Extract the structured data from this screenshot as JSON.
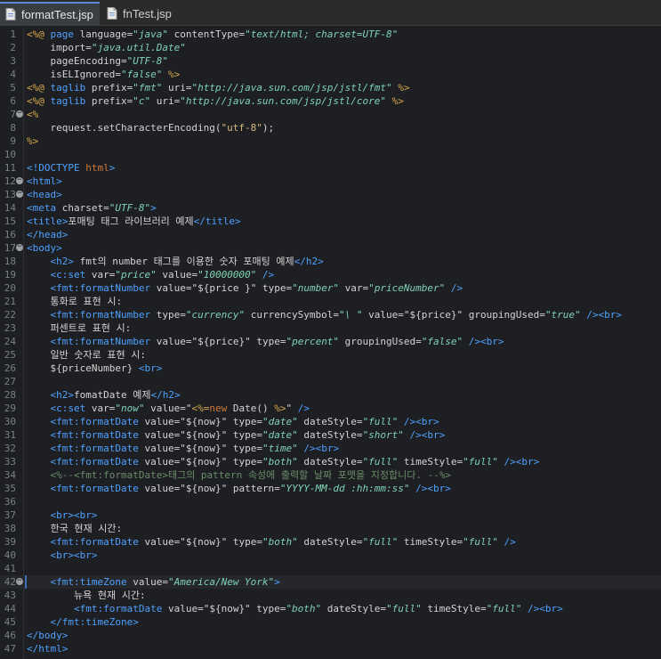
{
  "tabs": [
    {
      "label": "formatTest.jsp",
      "icon": "jsp-file-icon",
      "active": true
    },
    {
      "label": "fnTest.jsp",
      "icon": "jsp-file-icon",
      "active": false
    }
  ],
  "colors": {
    "background": "#1e1f22",
    "tag": "#4ea1ff",
    "value": "#7fd3b6",
    "comment": "#6a8d6a",
    "directive": "#d6a84a"
  },
  "editor": {
    "lines": [
      {
        "n": "1",
        "fold": false,
        "tokens": [
          [
            "dir",
            "<%@ "
          ],
          [
            "tag",
            "page "
          ],
          [
            "attr",
            "language="
          ],
          [
            "val",
            "\"java\""
          ],
          [
            "attr",
            " contentType="
          ],
          [
            "val",
            "\"text/html; charset=UTF-8\""
          ]
        ]
      },
      {
        "n": "2",
        "fold": false,
        "tokens": [
          [
            "attr",
            "    import="
          ],
          [
            "val",
            "\"java.util.Date\""
          ]
        ]
      },
      {
        "n": "3",
        "fold": false,
        "tokens": [
          [
            "attr",
            "    pageEncoding="
          ],
          [
            "val",
            "\"UTF-8\""
          ]
        ]
      },
      {
        "n": "4",
        "fold": false,
        "tokens": [
          [
            "attr",
            "    isELIgnored="
          ],
          [
            "val",
            "\"false\""
          ],
          [
            "dir",
            " %>"
          ]
        ]
      },
      {
        "n": "5",
        "fold": false,
        "tokens": [
          [
            "dir",
            "<%@ "
          ],
          [
            "tag",
            "taglib "
          ],
          [
            "attr",
            "prefix="
          ],
          [
            "val",
            "\"fmt\""
          ],
          [
            "attr",
            " uri="
          ],
          [
            "val",
            "\"http://java.sun.com/jsp/jstl/fmt\""
          ],
          [
            "dir",
            " %>"
          ]
        ]
      },
      {
        "n": "6",
        "fold": false,
        "tokens": [
          [
            "dir",
            "<%@ "
          ],
          [
            "tag",
            "taglib "
          ],
          [
            "attr",
            "prefix="
          ],
          [
            "val",
            "\"c\""
          ],
          [
            "attr",
            " uri="
          ],
          [
            "val",
            "\"http://java.sun.com/jsp/jstl/core\""
          ],
          [
            "dir",
            " %>"
          ]
        ]
      },
      {
        "n": "7",
        "fold": true,
        "tokens": [
          [
            "dir",
            "<%"
          ]
        ]
      },
      {
        "n": "8",
        "fold": false,
        "tokens": [
          [
            "plain",
            "    request.setCharacterEncoding("
          ],
          [
            "str",
            "\"utf-8\""
          ],
          [
            "plain",
            ");"
          ]
        ]
      },
      {
        "n": "9",
        "fold": false,
        "tokens": [
          [
            "dir",
            "%>"
          ]
        ]
      },
      {
        "n": "10",
        "fold": false,
        "tokens": []
      },
      {
        "n": "11",
        "fold": false,
        "tokens": [
          [
            "tag",
            "<!DOCTYPE "
          ],
          [
            "kw",
            "html"
          ],
          [
            "tag",
            ">"
          ]
        ]
      },
      {
        "n": "12",
        "fold": true,
        "tokens": [
          [
            "tag",
            "<html>"
          ]
        ]
      },
      {
        "n": "13",
        "fold": true,
        "tokens": [
          [
            "tag",
            "<head>"
          ]
        ]
      },
      {
        "n": "14",
        "fold": false,
        "tokens": [
          [
            "tag",
            "<meta "
          ],
          [
            "attr",
            "charset="
          ],
          [
            "val",
            "\"UTF-8\""
          ],
          [
            "tag",
            ">"
          ]
        ]
      },
      {
        "n": "15",
        "fold": false,
        "tokens": [
          [
            "tag",
            "<title>"
          ],
          [
            "plain",
            "포매팅 태그 라이브러리 예제"
          ],
          [
            "tag",
            "</title>"
          ]
        ]
      },
      {
        "n": "16",
        "fold": false,
        "tokens": [
          [
            "tag",
            "</head>"
          ]
        ]
      },
      {
        "n": "17",
        "fold": true,
        "tokens": [
          [
            "tag",
            "<body>"
          ]
        ]
      },
      {
        "n": "18",
        "fold": false,
        "tokens": [
          [
            "plain",
            "    "
          ],
          [
            "tag",
            "<h2>"
          ],
          [
            "plain",
            " fmt의 number 태그를 이용한 숫자 포매팅 예제"
          ],
          [
            "tag",
            "</h2>"
          ]
        ]
      },
      {
        "n": "19",
        "fold": false,
        "tokens": [
          [
            "plain",
            "    "
          ],
          [
            "tag",
            "<c:set "
          ],
          [
            "attr",
            "var="
          ],
          [
            "val",
            "\"price\""
          ],
          [
            "attr",
            " value="
          ],
          [
            "val",
            "\"10000000\""
          ],
          [
            "tag",
            " />"
          ]
        ]
      },
      {
        "n": "20",
        "fold": false,
        "tokens": [
          [
            "plain",
            "    "
          ],
          [
            "tag",
            "<fmt:formatNumber "
          ],
          [
            "attr",
            "value="
          ],
          [
            "plain",
            "\"${price }\""
          ],
          [
            "attr",
            " type="
          ],
          [
            "val",
            "\"number\""
          ],
          [
            "attr",
            " var="
          ],
          [
            "val",
            "\"priceNumber\""
          ],
          [
            "tag",
            " />"
          ]
        ]
      },
      {
        "n": "21",
        "fold": false,
        "tokens": [
          [
            "plain",
            "    통화로 표현 시:"
          ]
        ]
      },
      {
        "n": "22",
        "fold": false,
        "tokens": [
          [
            "plain",
            "    "
          ],
          [
            "tag",
            "<fmt:formatNumber "
          ],
          [
            "attr",
            "type="
          ],
          [
            "val",
            "\"currency\""
          ],
          [
            "attr",
            " currencySymbol="
          ],
          [
            "val",
            "\"\\ \""
          ],
          [
            "attr",
            " value="
          ],
          [
            "plain",
            "\"${price}\""
          ],
          [
            "attr",
            " groupingUsed="
          ],
          [
            "val",
            "\"true\""
          ],
          [
            "tag",
            " /><br>"
          ]
        ]
      },
      {
        "n": "23",
        "fold": false,
        "tokens": [
          [
            "plain",
            "    퍼센트로 표현 시:"
          ]
        ]
      },
      {
        "n": "24",
        "fold": false,
        "tokens": [
          [
            "plain",
            "    "
          ],
          [
            "tag",
            "<fmt:formatNumber "
          ],
          [
            "attr",
            "value="
          ],
          [
            "plain",
            "\"${price}\""
          ],
          [
            "attr",
            " type="
          ],
          [
            "val",
            "\"percent\""
          ],
          [
            "attr",
            " groupingUsed="
          ],
          [
            "val",
            "\"false\""
          ],
          [
            "tag",
            " /><br>"
          ]
        ]
      },
      {
        "n": "25",
        "fold": false,
        "tokens": [
          [
            "plain",
            "    일반 숫자로 표현 시:"
          ]
        ]
      },
      {
        "n": "26",
        "fold": false,
        "tokens": [
          [
            "plain",
            "    ${priceNumber} "
          ],
          [
            "tag",
            "<br>"
          ]
        ]
      },
      {
        "n": "27",
        "fold": false,
        "tokens": []
      },
      {
        "n": "28",
        "fold": false,
        "tokens": [
          [
            "plain",
            "    "
          ],
          [
            "tag",
            "<h2>"
          ],
          [
            "plain",
            "fomatDate 예제"
          ],
          [
            "tag",
            "</h2>"
          ]
        ]
      },
      {
        "n": "29",
        "fold": false,
        "tokens": [
          [
            "plain",
            "    "
          ],
          [
            "tag",
            "<c:set "
          ],
          [
            "attr",
            "var="
          ],
          [
            "val",
            "\"now\""
          ],
          [
            "attr",
            " value="
          ],
          [
            "plain",
            "\""
          ],
          [
            "dir",
            "<%="
          ],
          [
            "kw",
            "new"
          ],
          [
            "plain",
            " Date() "
          ],
          [
            "dir",
            "%>"
          ],
          [
            "plain",
            "\""
          ],
          [
            "tag",
            " />"
          ]
        ]
      },
      {
        "n": "30",
        "fold": false,
        "tokens": [
          [
            "plain",
            "    "
          ],
          [
            "tag",
            "<fmt:formatDate "
          ],
          [
            "attr",
            "value="
          ],
          [
            "plain",
            "\"${now}\""
          ],
          [
            "attr",
            " type="
          ],
          [
            "val",
            "\"date\""
          ],
          [
            "attr",
            " dateStyle="
          ],
          [
            "val",
            "\"full\""
          ],
          [
            "tag",
            " /><br>"
          ]
        ]
      },
      {
        "n": "31",
        "fold": false,
        "tokens": [
          [
            "plain",
            "    "
          ],
          [
            "tag",
            "<fmt:formatDate "
          ],
          [
            "attr",
            "value="
          ],
          [
            "plain",
            "\"${now}\""
          ],
          [
            "attr",
            " type="
          ],
          [
            "val",
            "\"date\""
          ],
          [
            "attr",
            " dateStyle="
          ],
          [
            "val",
            "\"short\""
          ],
          [
            "tag",
            " /><br>"
          ]
        ]
      },
      {
        "n": "32",
        "fold": false,
        "tokens": [
          [
            "plain",
            "    "
          ],
          [
            "tag",
            "<fmt:formatDate "
          ],
          [
            "attr",
            "value="
          ],
          [
            "plain",
            "\"${now}\""
          ],
          [
            "attr",
            " type="
          ],
          [
            "val",
            "\"time\""
          ],
          [
            "tag",
            " /><br>"
          ]
        ]
      },
      {
        "n": "33",
        "fold": false,
        "tokens": [
          [
            "plain",
            "    "
          ],
          [
            "tag",
            "<fmt:formatDate "
          ],
          [
            "attr",
            "value="
          ],
          [
            "plain",
            "\"${now}\""
          ],
          [
            "attr",
            " type="
          ],
          [
            "val",
            "\"both\""
          ],
          [
            "attr",
            " dateStyle="
          ],
          [
            "val",
            "\"full\""
          ],
          [
            "attr",
            " timeStyle="
          ],
          [
            "val",
            "\"full\""
          ],
          [
            "tag",
            " /><br>"
          ]
        ]
      },
      {
        "n": "34",
        "fold": false,
        "tokens": [
          [
            "plain",
            "    "
          ],
          [
            "comment",
            "<%--<fmt:formatDate>태그의 pattern 속성에 출력할 날짜 포맷을 지정합니다. --%>"
          ]
        ]
      },
      {
        "n": "35",
        "fold": false,
        "tokens": [
          [
            "plain",
            "    "
          ],
          [
            "tag",
            "<fmt:formatDate "
          ],
          [
            "attr",
            "value="
          ],
          [
            "plain",
            "\"${now}\""
          ],
          [
            "attr",
            " pattern="
          ],
          [
            "val",
            "\"YYYY-MM-dd :hh:mm:ss\""
          ],
          [
            "tag",
            " /><br>"
          ]
        ]
      },
      {
        "n": "36",
        "fold": false,
        "tokens": []
      },
      {
        "n": "37",
        "fold": false,
        "tokens": [
          [
            "plain",
            "    "
          ],
          [
            "tag",
            "<br><br>"
          ]
        ]
      },
      {
        "n": "38",
        "fold": false,
        "tokens": [
          [
            "plain",
            "    한국 현재 시간:"
          ]
        ]
      },
      {
        "n": "39",
        "fold": false,
        "tokens": [
          [
            "plain",
            "    "
          ],
          [
            "tag",
            "<fmt:formatDate "
          ],
          [
            "attr",
            "value="
          ],
          [
            "plain",
            "\"${now}\""
          ],
          [
            "attr",
            " type="
          ],
          [
            "val",
            "\"both\""
          ],
          [
            "attr",
            " dateStyle="
          ],
          [
            "val",
            "\"full\""
          ],
          [
            "attr",
            " timeStyle="
          ],
          [
            "val",
            "\"full\""
          ],
          [
            "tag",
            " />"
          ]
        ]
      },
      {
        "n": "40",
        "fold": false,
        "tokens": [
          [
            "plain",
            "    "
          ],
          [
            "tag",
            "<br><br>"
          ]
        ]
      },
      {
        "n": "41",
        "fold": false,
        "tokens": []
      },
      {
        "n": "42",
        "fold": true,
        "tokens": [
          [
            "plain",
            "    "
          ],
          [
            "tag",
            "<fmt:timeZone "
          ],
          [
            "attr",
            "value="
          ],
          [
            "val",
            "\"America/New York\""
          ],
          [
            "tag",
            ">"
          ]
        ]
      },
      {
        "n": "43",
        "fold": false,
        "tokens": [
          [
            "plain",
            "        뉴욕 현재 시간:"
          ]
        ]
      },
      {
        "n": "44",
        "fold": false,
        "tokens": [
          [
            "plain",
            "        "
          ],
          [
            "tag",
            "<fmt:formatDate "
          ],
          [
            "attr",
            "value="
          ],
          [
            "plain",
            "\"${now}\""
          ],
          [
            "attr",
            " type="
          ],
          [
            "val",
            "\"both\""
          ],
          [
            "attr",
            " dateStyle="
          ],
          [
            "val",
            "\"full\""
          ],
          [
            "attr",
            " timeStyle="
          ],
          [
            "val",
            "\"full\""
          ],
          [
            "tag",
            " /><br>"
          ]
        ]
      },
      {
        "n": "45",
        "fold": false,
        "tokens": [
          [
            "plain",
            "    "
          ],
          [
            "tag",
            "</fmt:timeZone>"
          ]
        ]
      },
      {
        "n": "46",
        "fold": false,
        "tokens": [
          [
            "tag",
            "</body>"
          ]
        ]
      },
      {
        "n": "47",
        "fold": false,
        "tokens": [
          [
            "tag",
            "</html>"
          ]
        ]
      }
    ]
  }
}
